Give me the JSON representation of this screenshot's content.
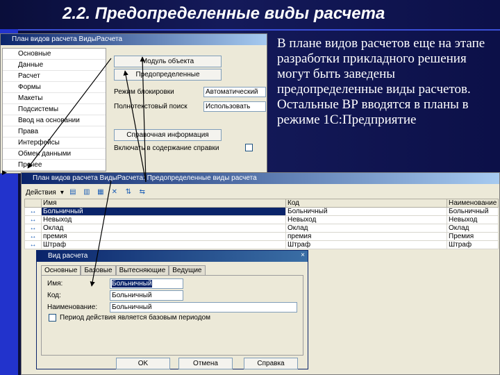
{
  "slide": {
    "title": "2.2. Предопределенные виды расчета",
    "body": "В плане видов расчетов еще на этапе разработки прикладного решения могут быть заведены предопределенные виды расчетов. Остальные ВР вводятся в планы в режиме 1С:Предприятие"
  },
  "plan_window": {
    "title": "План видов расчета ВидыРасчета",
    "sidebar": [
      "Основные",
      "Данные",
      "Расчет",
      "Формы",
      "Макеты",
      "Подсистемы",
      "Ввод на основании",
      "Права",
      "Интерфейсы",
      "Обмен данными",
      "Прочее"
    ],
    "module_button": "Модуль объекта",
    "predefined_button": "Предопределенные",
    "lock_mode_label": "Режим блокировки",
    "lock_mode_value": "Автоматический",
    "fulltext_label": "Полнотекстовый поиск",
    "fulltext_value": "Использовать",
    "help_button": "Справочная информация",
    "help_include_label": "Включать в содержание справки"
  },
  "list_window": {
    "title": "План видов расчета ВидыРасчета: Предопределенные виды расчета",
    "actions_label": "Действия",
    "columns": [
      "Имя",
      "Код",
      "Наименование"
    ],
    "rows": [
      {
        "name": "Больничный",
        "code": "Больничный",
        "title": "Больничный"
      },
      {
        "name": "Невыход",
        "code": "Невыход",
        "title": "Невыход"
      },
      {
        "name": "Оклад",
        "code": "Оклад",
        "title": "Оклад"
      },
      {
        "name": "премия",
        "code": "премия",
        "title": "Премия"
      },
      {
        "name": "Штраф",
        "code": "Штраф",
        "title": "Штраф"
      }
    ]
  },
  "dialog": {
    "title": "Вид расчета",
    "close_glyph": "×",
    "tabs": [
      "Основные",
      "Базовые",
      "Вытесняющие",
      "Ведущие"
    ],
    "name_label": "Имя:",
    "name_value": "Больничный",
    "code_label": "Код:",
    "code_value": "Больничный",
    "desc_label": "Наименование:",
    "desc_value": "Больничный",
    "period_checkbox_label": "Период действия является базовым периодом",
    "ok": "OK",
    "cancel": "Отмена",
    "help": "Справка"
  },
  "icons": {
    "row_marker": "arrow-left-right-icon",
    "side_marker": "triangle-right-icon"
  },
  "colors": {
    "background": "#0c1048",
    "accent": "#2233cc",
    "selection": "#0a246a"
  }
}
